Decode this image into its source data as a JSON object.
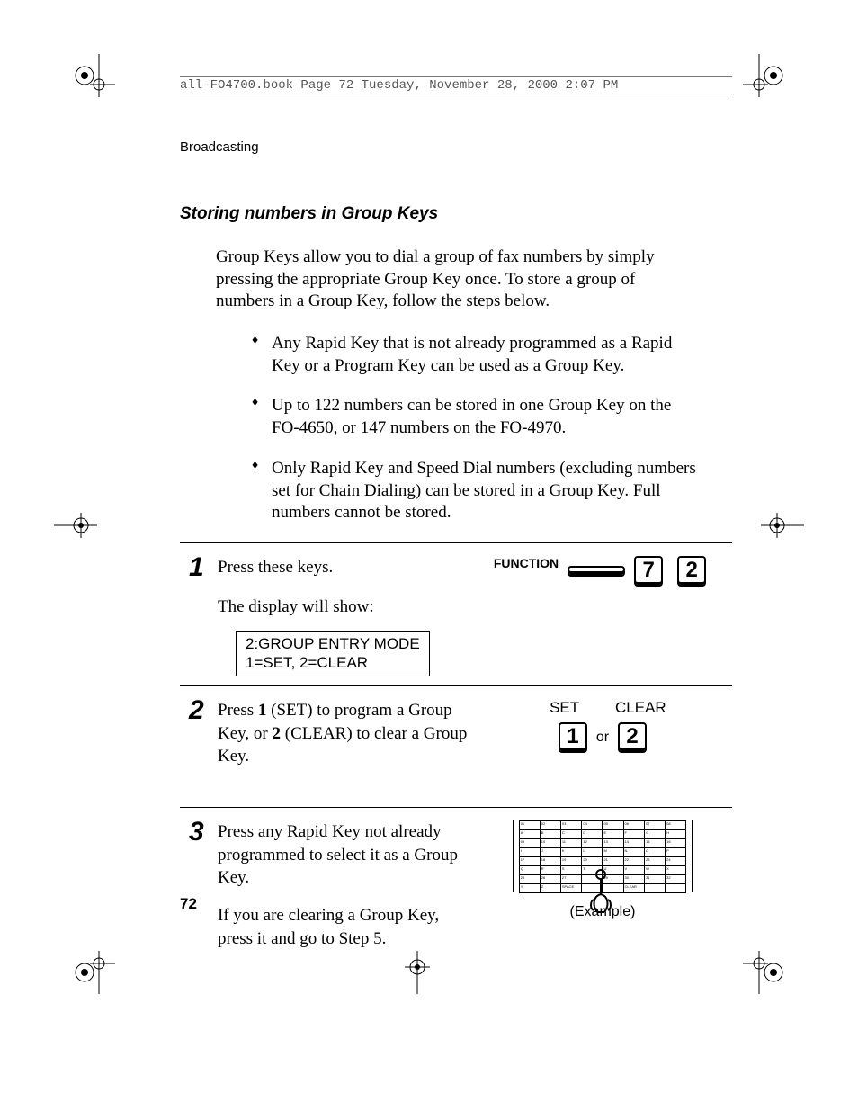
{
  "meta": {
    "header": "all-FO4700.book  Page 72  Tuesday, November 28, 2000  2:07 PM",
    "chapter": "Broadcasting",
    "page_number": "72",
    "section_title": "Storing numbers in Group Keys"
  },
  "intro": "Group Keys allow you to dial a group of fax numbers by simply pressing the appropriate Group Key once. To store a group of numbers in a Group Key, follow the steps below.",
  "bullets": [
    "Any Rapid Key that is not already programmed as a Rapid Key or a Program Key can be used as a Group Key.",
    "Up to 122 numbers can be stored in one Group Key on the FO-4650, or 147 numbers on the FO-4970.",
    "Only Rapid Key and Speed Dial numbers (excluding numbers set for Chain Dialing) can be stored in a Group Key. Full numbers cannot be stored."
  ],
  "steps": {
    "s1": {
      "num": "1",
      "text_a": "Press these keys.",
      "text_b": "The display will show:",
      "display_line1": "2:GROUP ENTRY MODE",
      "display_line2": "1=SET, 2=CLEAR",
      "function_label": "FUNCTION",
      "key_a": "7",
      "key_b": "2"
    },
    "s2": {
      "num": "2",
      "text_before": "Press ",
      "bold_1": "1",
      "text_mid1": " (SET) to program a Group Key, or ",
      "bold_2": "2",
      "text_mid2": " (CLEAR) to clear a Group Key.",
      "label_set": "SET",
      "label_clear": "CLEAR",
      "key_a": "1",
      "or": "or",
      "key_b": "2"
    },
    "s3": {
      "num": "3",
      "text_a": "Press any Rapid Key not already programmed to select it as a Group Key.",
      "text_b": "If you are clearing a Group Key, press it and go to Step 5.",
      "example": "(Example)"
    }
  }
}
